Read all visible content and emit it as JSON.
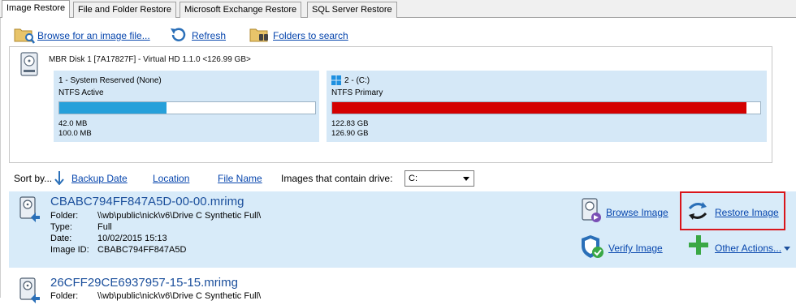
{
  "tabs": [
    {
      "label": "Image Restore"
    },
    {
      "label": "File and Folder Restore"
    },
    {
      "label": "Microsoft Exchange Restore"
    },
    {
      "label": "SQL Server Restore"
    }
  ],
  "toolbar": {
    "browse_label": "Browse for an image file...",
    "refresh_label": "Refresh",
    "folders_label": "Folders to search"
  },
  "disk": {
    "title": "MBR Disk 1 [7A17827F] - Virtual HD 1.1.0  <126.99 GB>",
    "partitions": [
      {
        "title": "1 - System Reserved (None)",
        "type": "NTFS Active",
        "used": "42.0 MB",
        "total": "100.0 MB",
        "fill_fraction": 0.42,
        "color": "#26a0da"
      },
      {
        "title": "2 -  (C:)",
        "type": "NTFS Primary",
        "used": "122.83 GB",
        "total": "126.90 GB",
        "fill_fraction": 0.968,
        "color": "#d40000"
      }
    ]
  },
  "sort": {
    "label": "Sort by...",
    "options": [
      "Backup Date",
      "Location",
      "File Name"
    ],
    "drive_label": "Images that contain drive:",
    "drive_value": "C:"
  },
  "images": [
    {
      "name": "CBABC794FF847A5D-00-00.mrimg",
      "meta": [
        {
          "key": "Folder:",
          "value": "\\\\wb\\public\\nick\\v6\\Drive C Synthetic Full\\"
        },
        {
          "key": "Type:",
          "value": "Full"
        },
        {
          "key": "Date:",
          "value": "10/02/2015 15:13"
        },
        {
          "key": "Image ID:",
          "value": "CBABC794FF847A5D"
        }
      ]
    },
    {
      "name": "26CFF29CE6937957-15-15.mrimg",
      "meta": [
        {
          "key": "Folder:",
          "value": "\\\\wb\\public\\nick\\v6\\Drive C Synthetic Full\\"
        }
      ]
    }
  ],
  "actions": {
    "browse_image": "Browse Image",
    "restore_image": "Restore Image",
    "verify_image": "Verify Image",
    "other_actions": "Other Actions..."
  },
  "colors": {
    "selected_row": "#d8ebf9",
    "partition_bg": "#d5e8f7",
    "highlight_border": "#d9151b",
    "link": "#0645ad"
  }
}
